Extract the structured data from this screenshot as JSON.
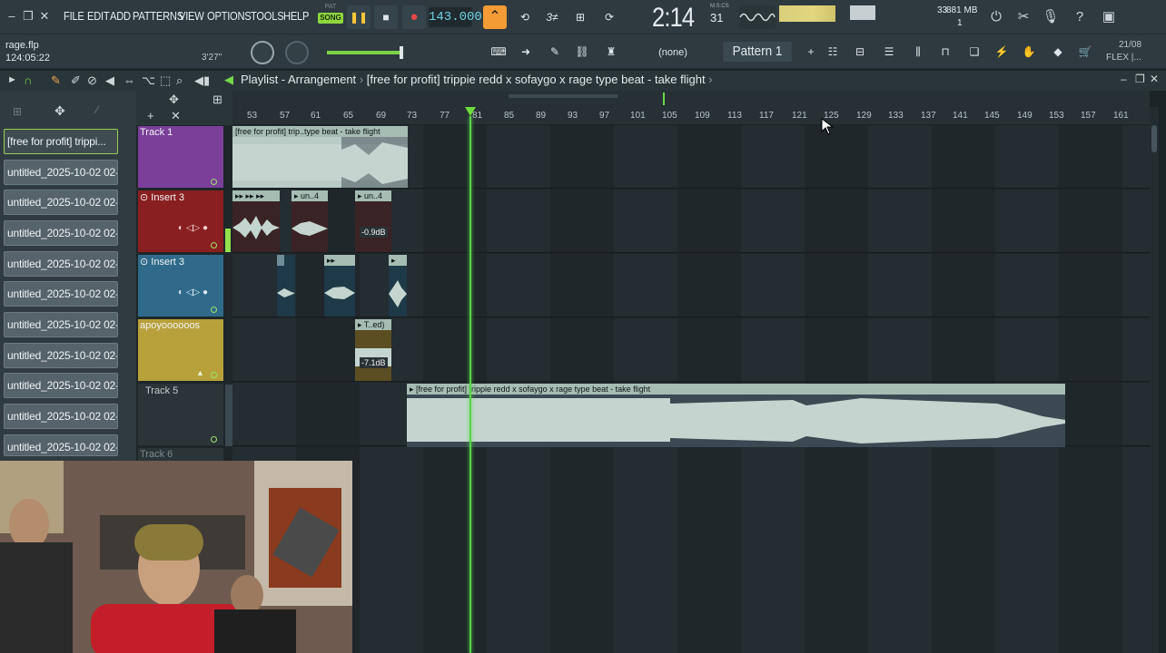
{
  "menu": [
    "FILE",
    "EDIT",
    "ADD",
    "PATTERNS",
    "VIEW",
    "OPTIONS",
    "TOOLS",
    "HELP"
  ],
  "transport": {
    "mode_top": "PAT",
    "mode_bottom": "SONG",
    "tempo": "143.000"
  },
  "clock": {
    "time": "2:14",
    "ms": "31",
    "mode": "M:S:CS"
  },
  "status": {
    "poly": "33",
    "memory": "881 MB",
    "poly_sub": "1"
  },
  "project": {
    "filename": "rage.flp",
    "elapsed": "124:05:22",
    "small_time": "3'27\""
  },
  "toolbar": {
    "snap": "(none)",
    "pattern": "Pattern 1",
    "date": "21/08",
    "flex": "FLEX |..."
  },
  "playlist": {
    "title": "Playlist - Arrangement",
    "breadcrumb": "[free for profit] trippie redd x sofaygo x rage type beat - take flight"
  },
  "ruler": [
    "53",
    "57",
    "61",
    "65",
    "69",
    "73",
    "77",
    "81",
    "85",
    "89",
    "93",
    "97",
    "101",
    "105",
    "109",
    "113",
    "117",
    "121",
    "125",
    "129",
    "133",
    "137",
    "141",
    "145",
    "149",
    "153",
    "157",
    "161"
  ],
  "picker": [
    "[free for profit] trippi...",
    "untitled_2025-10-02 02-...",
    "untitled_2025-10-02 02-...",
    "untitled_2025-10-02 02-...",
    "untitled_2025-10-02 02-...",
    "untitled_2025-10-02 02-...",
    "untitled_2025-10-02 02-...",
    "untitled_2025-10-02 02-...",
    "untitled_2025-10-02 02-...",
    "untitled_2025-10-02 02-...",
    "untitled_2025-10-02 02-..."
  ],
  "tracks": [
    {
      "name": "Track 1",
      "color": "#7b3f9a"
    },
    {
      "name": "Insert 3",
      "color": "#8a1f22"
    },
    {
      "name": "Insert 3",
      "color": "#2f6a8a"
    },
    {
      "name": "apoyoooooos",
      "color": "#b8a13a"
    },
    {
      "name": "Track 5",
      "color": "#2b3438"
    },
    {
      "name": "Track 6",
      "color": "#2b3438"
    }
  ],
  "clips": {
    "track1": "[free for profit] trip..type beat - take flight",
    "insert_a": "un..4",
    "insert_b": "un..4",
    "gain_a": "-0.9dB",
    "apoyo": "T..ed)",
    "gain_b": "-7.1dB",
    "track5": "[free for profit] trippie redd x sofaygo x rage type beat - take flight"
  }
}
